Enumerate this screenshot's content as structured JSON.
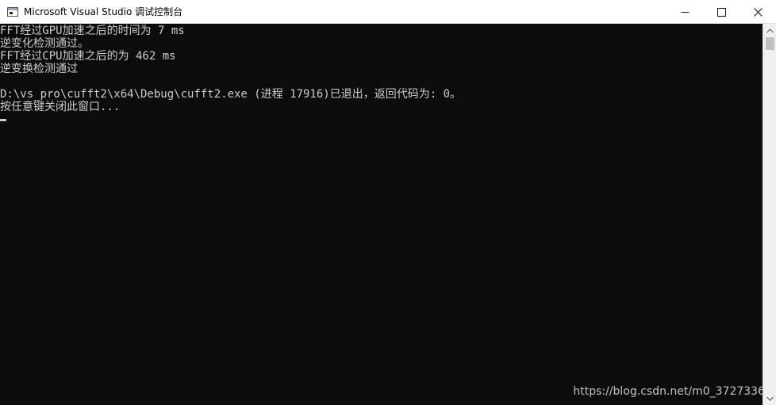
{
  "window": {
    "title": "Microsoft Visual Studio 调试控制台",
    "icon": "console-app-icon",
    "controls": {
      "minimize": "minimize-icon",
      "maximize": "maximize-icon",
      "close": "close-icon"
    }
  },
  "console": {
    "background": "#0c0c0c",
    "foreground": "#cccccc",
    "lines": [
      "FFT经过GPU加速之后的时间为 7 ms",
      "逆变化检测通过。",
      "FFT经过CPU加速之后的为 462 ms",
      "逆变换检测通过",
      "",
      "D:\\vs_pro\\cufft2\\x64\\Debug\\cufft2.exe (进程 17916)已退出，返回代码为: 0。",
      "按任意键关闭此窗口..."
    ]
  },
  "watermark": "https://blog.csdn.net/m0_3727336"
}
